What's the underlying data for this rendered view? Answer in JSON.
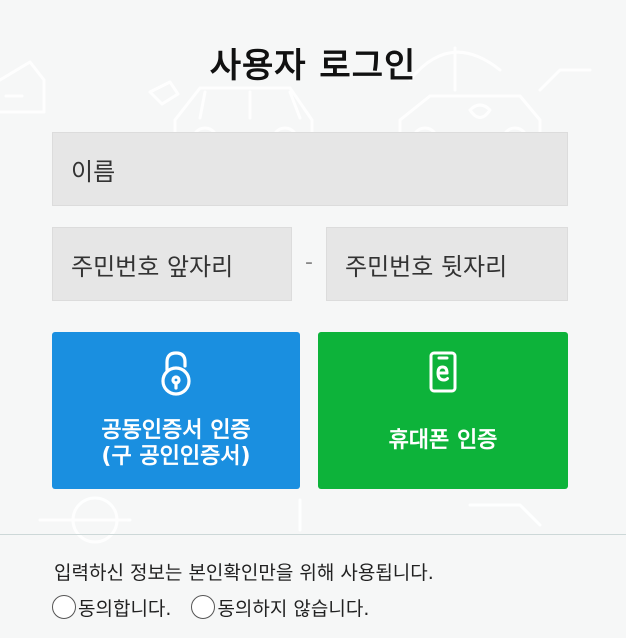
{
  "title": "사용자 로그인",
  "fields": {
    "name_placeholder": "이름",
    "rrn_front_placeholder": "주민번호 앞자리",
    "rrn_separator": "-",
    "rrn_back_placeholder": "주민번호 뒷자리"
  },
  "buttons": {
    "cert": {
      "line1": "공동인증서 인증",
      "line2": "(구 공인인증서)",
      "color": "#1a8fe0",
      "icon": "padlock-icon"
    },
    "phone": {
      "label": "휴대폰 인증",
      "color": "#0db33a",
      "icon": "smartphone-icon"
    }
  },
  "consent": {
    "notice": "입력하신 정보는 본인확인만을 위해 사용됩니다.",
    "agree_label": "동의합니다.",
    "disagree_label": "동의하지 않습니다."
  }
}
